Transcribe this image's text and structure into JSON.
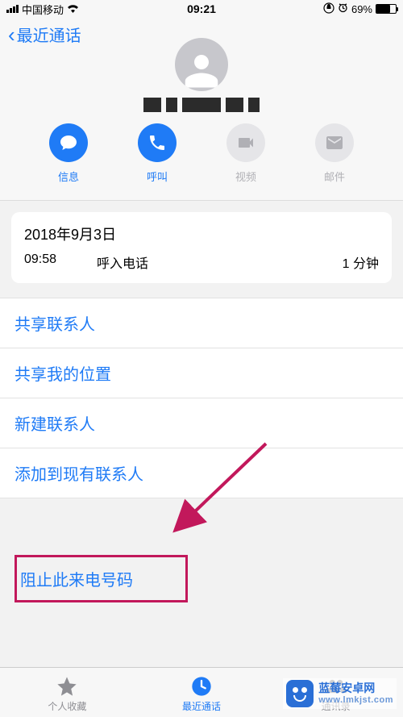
{
  "status": {
    "carrier": "中国移动",
    "time": "09:21",
    "battery_pct": "69%"
  },
  "header": {
    "back_label": "最近通话"
  },
  "actions": {
    "message": "信息",
    "call": "呼叫",
    "video": "视频",
    "mail": "邮件"
  },
  "call_log": {
    "date": "2018年9月3日",
    "time": "09:58",
    "type": "呼入电话",
    "duration": "1 分钟"
  },
  "list": {
    "share_contact": "共享联系人",
    "share_location": "共享我的位置",
    "new_contact": "新建联系人",
    "add_existing": "添加到现有联系人"
  },
  "block": {
    "label": "阻止此来电号码"
  },
  "tabs": {
    "favorites": "个人收藏",
    "recents": "最近通话",
    "contacts": "通讯录"
  },
  "watermark": {
    "title": "蓝莓安卓网",
    "sub": "www.lmkjst.com"
  }
}
